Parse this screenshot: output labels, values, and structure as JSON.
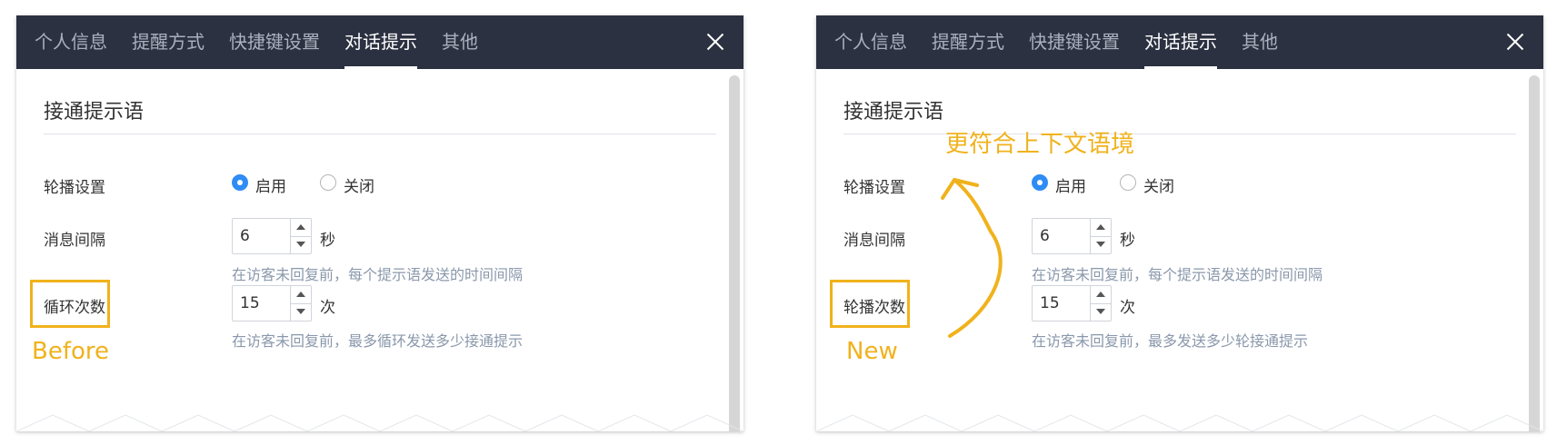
{
  "tabs": [
    "个人信息",
    "提醒方式",
    "快捷键设置",
    "对话提示",
    "其他"
  ],
  "active_tab": "对话提示",
  "section_title": "接通提示语",
  "carousel": {
    "label": "轮播设置",
    "option_on": "启用",
    "option_off": "关闭",
    "selected": "启用"
  },
  "interval": {
    "label": "消息间隔",
    "value": "6",
    "unit": "秒",
    "hint": "在访客未回复前，每个提示语发送的时间间隔"
  },
  "before": {
    "count_label": "循环次数",
    "count_value": "15",
    "count_unit": "次",
    "count_hint": "在访客未回复前，最多循环发送多少接通提示",
    "caption": "Before"
  },
  "after": {
    "count_label": "轮播次数",
    "count_value": "15",
    "count_unit": "次",
    "count_hint": "在访客未回复前，最多发送多少轮接通提示",
    "caption": "New"
  },
  "annotation": "更符合上下文语境",
  "colors": {
    "tabbar": "#2b3140",
    "accent": "#2f8cf5",
    "highlight": "#f0b21c",
    "hint": "#8a98ab"
  }
}
